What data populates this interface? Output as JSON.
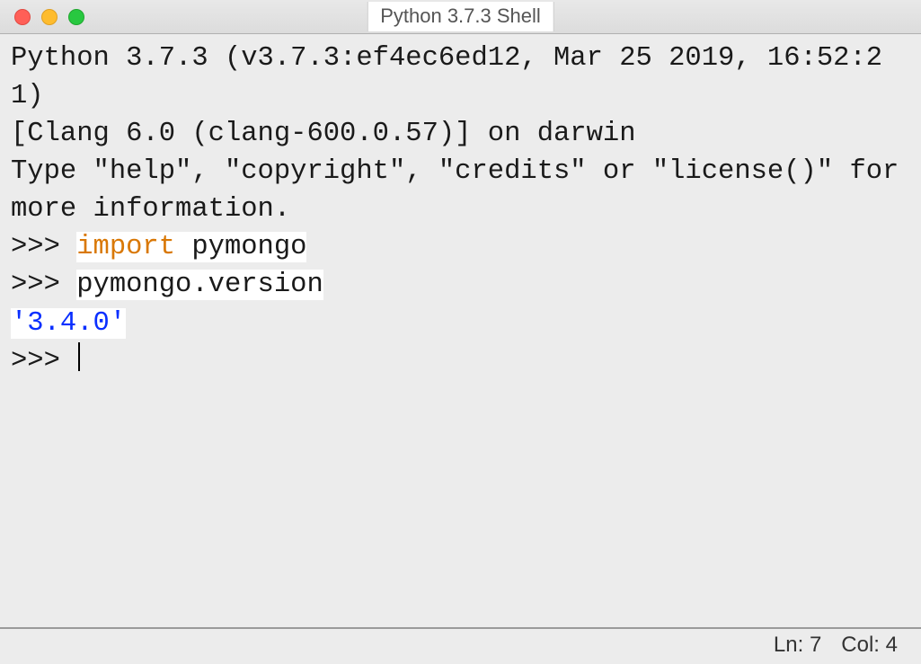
{
  "window": {
    "title": "Python 3.7.3 Shell"
  },
  "banner": {
    "line1": "Python 3.7.3 (v3.7.3:ef4ec6ed12, Mar 25 2019, 16:52:21) ",
    "line2": "[Clang 6.0 (clang-600.0.57)] on darwin",
    "line3": "Type \"help\", \"copyright\", \"credits\" or \"license()\" for more information."
  },
  "session": {
    "prompt": ">>> ",
    "cmd1_kw": "import",
    "cmd1_rest": " pymongo",
    "cmd2": "pymongo.version",
    "output1": "'3.4.0'"
  },
  "status": {
    "ln": "Ln: 7",
    "col": "Col: 4"
  }
}
